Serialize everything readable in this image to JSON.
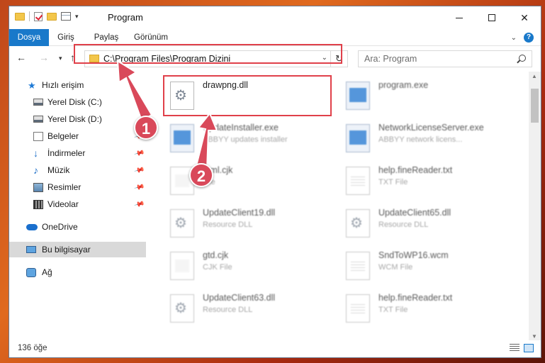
{
  "window": {
    "title": "Program"
  },
  "ribbon": {
    "tabs": [
      "Dosya",
      "Giriş",
      "Paylaş",
      "Görünüm"
    ]
  },
  "address": {
    "path": "C:\\Program Files\\Program Dizini"
  },
  "search": {
    "placeholder": "Ara: Program"
  },
  "sidebar": {
    "items": [
      {
        "label": "Hızlı erişim",
        "icon": "star-icon"
      },
      {
        "label": "Yerel Disk (C:)",
        "icon": "drive-icon"
      },
      {
        "label": "Yerel Disk (D:)",
        "icon": "drive-icon"
      },
      {
        "label": "Belgeler",
        "icon": "documents-icon",
        "pinned": true
      },
      {
        "label": "İndirmeler",
        "icon": "downloads-icon",
        "pinned": true
      },
      {
        "label": "Müzik",
        "icon": "music-icon",
        "pinned": true
      },
      {
        "label": "Resimler",
        "icon": "pictures-icon",
        "pinned": true
      },
      {
        "label": "Videolar",
        "icon": "videos-icon",
        "pinned": true
      },
      {
        "label": "OneDrive",
        "icon": "onedrive-icon"
      },
      {
        "label": "Bu bilgisayar",
        "icon": "computer-icon",
        "selected": true
      },
      {
        "label": "Ağ",
        "icon": "network-icon"
      }
    ]
  },
  "files": [
    {
      "name": "drawpng.dll",
      "type": "",
      "icon": "dll",
      "highlighted": true
    },
    {
      "name": "program.exe",
      "type": "",
      "icon": "exe"
    },
    {
      "name": "UpdateInstaller.exe",
      "type": "ABBYY updates installer",
      "icon": "exe"
    },
    {
      "name": "NetworkLicenseServer.exe",
      "type": "ABBYY network licens...",
      "icon": "exe"
    },
    {
      "name": "html.cjk",
      "type": "File",
      "icon": "cjk"
    },
    {
      "name": "help.fineReader.txt",
      "type": "TXT File",
      "icon": "txt"
    },
    {
      "name": "UpdateClient19.dll",
      "type": "Resource DLL",
      "icon": "dll"
    },
    {
      "name": "UpdateClient65.dll",
      "type": "Resource DLL",
      "icon": "dll"
    },
    {
      "name": "gtd.cjk",
      "type": "CJK File",
      "icon": "cjk"
    },
    {
      "name": "SndToWP16.wcm",
      "type": "WCM File",
      "icon": "txt"
    },
    {
      "name": "UpdateClient63.dll",
      "type": "Resource DLL",
      "icon": "dll"
    },
    {
      "name": "help.fineReader.txt",
      "type": "TXT File",
      "icon": "txt"
    }
  ],
  "status": {
    "count": "136 öğe"
  },
  "annotations": {
    "step1": "1",
    "step2": "2"
  },
  "colors": {
    "accent": "#1979ca",
    "highlight": "#e0404a",
    "badge": "#d9495a"
  }
}
